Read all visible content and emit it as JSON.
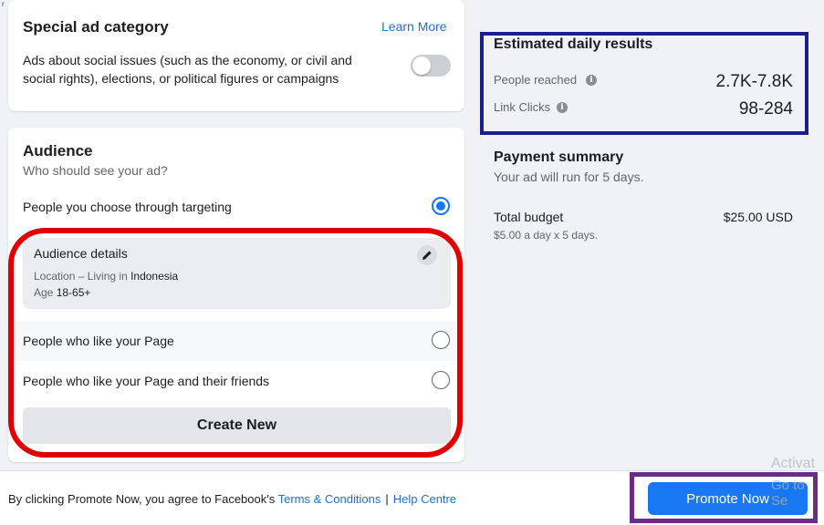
{
  "corner_mark": "r",
  "special_ad": {
    "title": "Special ad category",
    "learn_more": "Learn More",
    "description_line1": "Ads about social issues (such as the economy, or civil and",
    "description_line2": "social rights), elections, or political figures or campaigns",
    "toggle_on": false
  },
  "audience": {
    "title": "Audience",
    "subtitle": "Who should see your ad?",
    "option_targeting": "People you choose through targeting",
    "details": {
      "title": "Audience details",
      "location_prefix": "Location – Living in ",
      "location_value": "Indonesia",
      "age_prefix": "Age ",
      "age_value": "18-65+"
    },
    "option_page_likes": "People who like your Page",
    "option_page_friends": "People who like your Page and their friends",
    "create_new": "Create New",
    "selected_option": "targeting"
  },
  "estimated": {
    "title": "Estimated daily results",
    "people_reached_label": "People reached",
    "people_reached_value": "2.7K-7.8K",
    "link_clicks_label": "Link Clicks",
    "link_clicks_value": "98-284"
  },
  "payment": {
    "title": "Payment summary",
    "subtitle": "Your ad will run for 5 days.",
    "total_label": "Total budget",
    "total_value": "$25.00 USD",
    "breakdown": "$5.00 a day x 5 days."
  },
  "footer": {
    "prefix": "By clicking Promote Now, you agree to Facebook's ",
    "terms": "Terms & Conditions",
    "separator": "|",
    "help": "Help Centre",
    "promote": "Promote Now"
  },
  "watermark": {
    "line1": "Activat",
    "line2": "Go to Se"
  },
  "colors": {
    "accent": "#1877f2",
    "link": "#216fdb",
    "highlight_red": "#e30000",
    "highlight_navy": "#1a1f8a",
    "highlight_purple": "#6d2c84"
  }
}
